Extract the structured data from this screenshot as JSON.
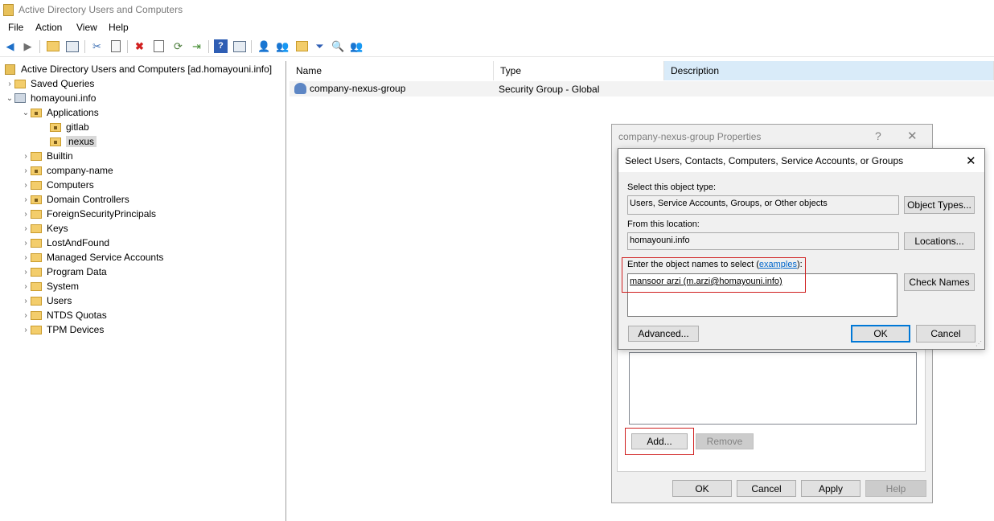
{
  "window": {
    "title": "Active Directory Users and Computers"
  },
  "menu": [
    "File",
    "Action",
    "View",
    "Help"
  ],
  "toolbar_icons": [
    "back-arrow-icon",
    "forward-arrow-icon",
    "up-folder-icon",
    "show-hide-tree-icon",
    "cut-icon",
    "copy-icon",
    "delete-icon",
    "properties-icon",
    "refresh-icon",
    "export-list-icon",
    "help-icon",
    "console-icon",
    "new-user-icon",
    "new-group-icon",
    "new-ou-icon",
    "filter-icon",
    "find-icon",
    "add-to-group-icon"
  ],
  "tree": {
    "root": "Active Directory Users and Computers [ad.homayouni.info]",
    "saved_queries": "Saved Queries",
    "domain": "homayouni.info",
    "applications": "Applications",
    "gitlab": "gitlab",
    "nexus": "nexus",
    "items": [
      "Builtin",
      "company-name",
      "Computers",
      "Domain Controllers",
      "ForeignSecurityPrincipals",
      "Keys",
      "LostAndFound",
      "Managed Service Accounts",
      "Program Data",
      "System",
      "Users",
      "NTDS Quotas",
      "TPM Devices"
    ]
  },
  "list": {
    "columns": [
      "Name",
      "Type",
      "Description"
    ],
    "rows": [
      {
        "name": "company-nexus-group",
        "type": "Security Group - Global",
        "description": ""
      }
    ]
  },
  "properties_dialog": {
    "title": "company-nexus-group Properties",
    "help_glyph": "?",
    "close_glyph": "✕",
    "add": "Add...",
    "remove": "Remove",
    "ok": "OK",
    "cancel": "Cancel",
    "apply": "Apply",
    "help": "Help"
  },
  "select_dialog": {
    "title": "Select Users, Contacts, Computers, Service Accounts, or Groups",
    "close_glyph": "✕",
    "object_type_label": "Select this object type:",
    "object_type_value": "Users, Service Accounts, Groups, or Other objects",
    "object_types_button": "Object Types...",
    "location_label": "From this location:",
    "location_value": "homayouni.info",
    "locations_button": "Locations...",
    "names_label_prefix": "Enter the object names to select (",
    "names_label_link": "examples",
    "names_label_suffix": "):",
    "names_value": "mansoor arzi (m.arzi@homayouni.info)",
    "check_names_button": "Check Names",
    "advanced_button": "Advanced...",
    "ok_button": "OK",
    "cancel_button": "Cancel"
  },
  "colors": {
    "highlight_box": "#d02020",
    "primary_button_border": "#0078d7",
    "link": "#0066cc"
  }
}
